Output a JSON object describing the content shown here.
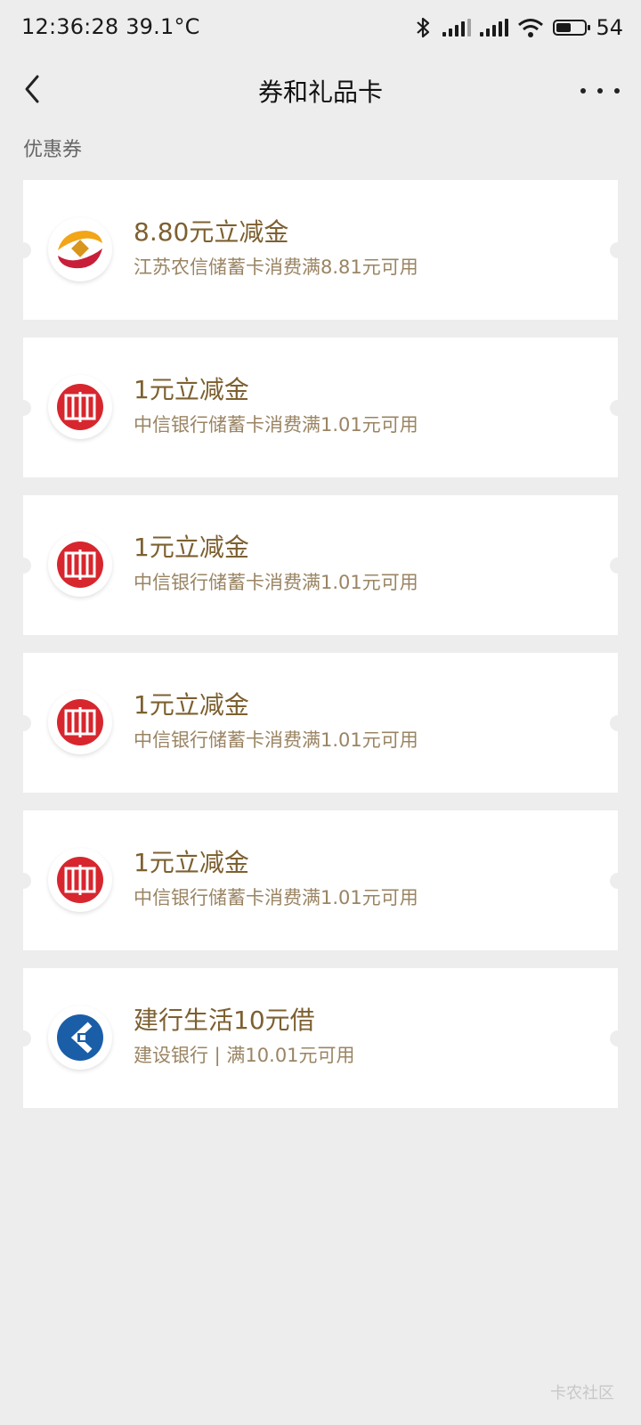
{
  "status": {
    "time_temp": "12:36:28 39.1°C",
    "battery": "54",
    "battery_level": 0.54
  },
  "nav": {
    "title": "券和礼品卡"
  },
  "section": {
    "label": "优惠券"
  },
  "coupons": [
    {
      "name": "8.80元立减金",
      "desc": "江苏农信储蓄卡消费满8.81元可用",
      "logo": "jsrcu-logo-icon"
    },
    {
      "name": "1元立减金",
      "desc": "中信银行储蓄卡消费满1.01元可用",
      "logo": "citic-logo-icon"
    },
    {
      "name": "1元立减金",
      "desc": "中信银行储蓄卡消费满1.01元可用",
      "logo": "citic-logo-icon"
    },
    {
      "name": "1元立减金",
      "desc": "中信银行储蓄卡消费满1.01元可用",
      "logo": "citic-logo-icon"
    },
    {
      "name": "1元立减金",
      "desc": "中信银行储蓄卡消费满1.01元可用",
      "logo": "citic-logo-icon"
    },
    {
      "name": "建行生活10元借",
      "desc": "建设银行 | 满10.01元可用",
      "logo": "ccb-logo-icon"
    }
  ],
  "watermark": "卡农社区",
  "colors": {
    "coupon_title": "#7d6030",
    "coupon_desc": "#9a8463",
    "background": "#ededed",
    "citic_red": "#d7262e",
    "ccb_blue": "#1a5ea8"
  }
}
